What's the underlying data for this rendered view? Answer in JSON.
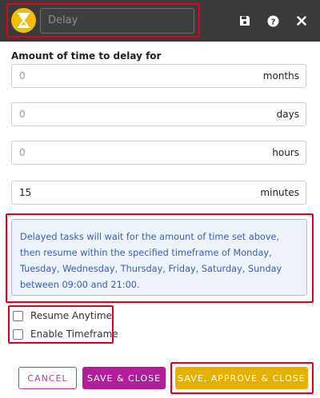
{
  "header": {
    "title_placeholder": "Delay",
    "icons": {
      "type": "hourglass-icon",
      "save": "floppy-disk-icon",
      "help": "help-circle-icon",
      "close": "close-icon"
    }
  },
  "form": {
    "label": "Amount of time to delay for",
    "fields": [
      {
        "value": "0",
        "unit": "months"
      },
      {
        "value": "0",
        "unit": "days"
      },
      {
        "value": "0",
        "unit": "hours"
      },
      {
        "value": "15",
        "unit": "minutes"
      }
    ]
  },
  "info": {
    "text": "Delayed tasks will wait for the amount of time set above, then resume within the specified timeframe of Monday, Tuesday, Wednesday, Thursday, Friday, Saturday, Sunday between 09:00 and 21:00."
  },
  "options": [
    {
      "label": "Resume Anytime",
      "checked": false
    },
    {
      "label": "Enable Timeframe",
      "checked": false
    }
  ],
  "buttons": {
    "cancel": "CANCEL",
    "save_close": "SAVE & CLOSE",
    "save_approve_close": "SAVE, APPROVE & CLOSE"
  },
  "colors": {
    "header_bg": "#3a3a3a",
    "accent_yellow": "#e5b000",
    "accent_magenta": "#b01e9b",
    "info_text": "#3b5fb0",
    "highlight_red": "#e2001a"
  }
}
